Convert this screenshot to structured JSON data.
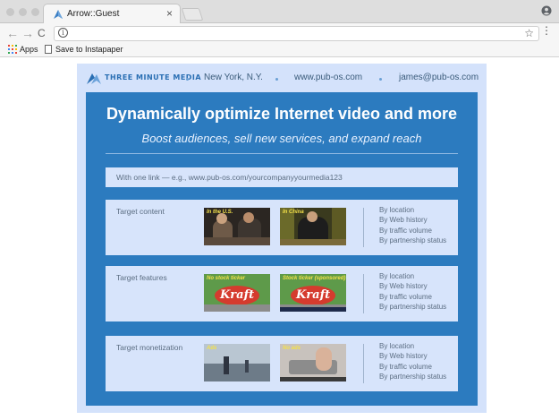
{
  "browser": {
    "tab_title": "Arrow::Guest",
    "tab_close": "×",
    "nav": {
      "back": "←",
      "forward": "→",
      "reload": "C"
    },
    "omnibox_info": "i",
    "star": "☆",
    "menu": "⋮",
    "bookmarks": {
      "apps_label": "Apps",
      "instapaper_label": "Save to Instapaper"
    }
  },
  "header": {
    "brand": "THREE MINUTE MEDIA",
    "location": "New York, N.Y.",
    "website": "www.pub-os.com",
    "email": "james@pub-os.com"
  },
  "hero": {
    "headline": "Dynamically optimize Internet video and more",
    "subhead": "Boost audiences, sell new services, and expand reach"
  },
  "link_bar": "With one link — e.g., www.pub-os.com/yourcompanyyourmedia123",
  "cards": [
    {
      "title": "Target content",
      "thumbs": [
        "In the U.S.",
        "In China"
      ],
      "options": [
        "By location",
        "By Web history",
        "By traffic volume",
        "By partnership status"
      ]
    },
    {
      "title": "Target features",
      "thumbs": [
        "No stock ticker",
        "Stock ticker (sponsored)"
      ],
      "options": [
        "By location",
        "By Web history",
        "By traffic volume",
        "By partnership status"
      ]
    },
    {
      "title": "Target monetization",
      "thumbs": [
        "Ads",
        "No ads"
      ],
      "options": [
        "By location",
        "By Web history",
        "By traffic volume",
        "By partnership status"
      ]
    }
  ],
  "kraft_text": "Kraft",
  "colors": {
    "accent": "#2c7bbf",
    "page_bg": "#d4e2fb",
    "card_bg": "#d7e4fb"
  }
}
